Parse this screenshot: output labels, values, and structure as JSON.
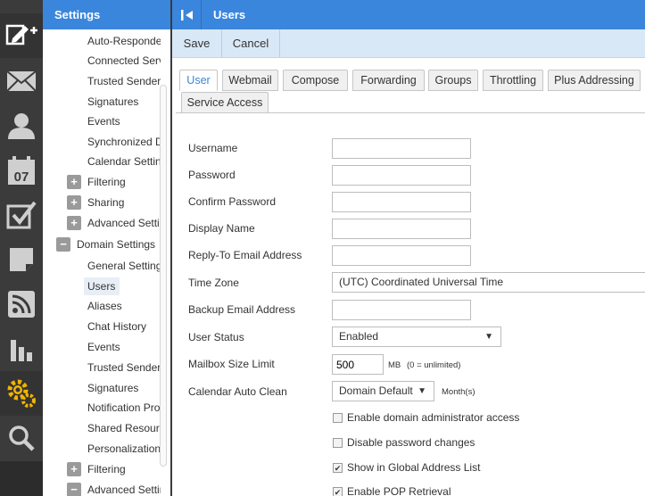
{
  "rail": {
    "items": [
      {
        "icon": "compose-new-icon",
        "active": true
      },
      {
        "icon": "mail-icon"
      },
      {
        "icon": "contacts-icon"
      },
      {
        "icon": "calendar-icon",
        "badge": "07"
      },
      {
        "icon": "tasks-icon"
      },
      {
        "icon": "notes-icon"
      },
      {
        "icon": "rss-icon"
      },
      {
        "icon": "reports-icon"
      },
      {
        "icon": "settings-gear-icon",
        "active": true
      },
      {
        "icon": "search-icon"
      }
    ],
    "accent_color": "#f2b400"
  },
  "tree": {
    "header": "Settings",
    "items": [
      {
        "label": "Auto-Responder"
      },
      {
        "label": "Connected Services"
      },
      {
        "label": "Trusted Senders"
      },
      {
        "label": "Signatures"
      },
      {
        "label": "Events"
      },
      {
        "label": "Synchronized Devices"
      },
      {
        "label": "Calendar Settings"
      },
      {
        "label": "Filtering",
        "expander": "+"
      },
      {
        "label": "Sharing",
        "expander": "+"
      },
      {
        "label": "Advanced Settings",
        "expander": "+"
      },
      {
        "label": "Domain Settings",
        "expander": "−"
      },
      {
        "label": "General Settings"
      },
      {
        "label": "Users",
        "selected": true
      },
      {
        "label": "Aliases"
      },
      {
        "label": "Chat History"
      },
      {
        "label": "Events"
      },
      {
        "label": "Trusted Senders"
      },
      {
        "label": "Signatures"
      },
      {
        "label": "Notification Profiles"
      },
      {
        "label": "Shared Resources"
      },
      {
        "label": "Personalization"
      },
      {
        "label": "Filtering",
        "expander": "+"
      },
      {
        "label": "Advanced Settings",
        "expander": "−"
      }
    ]
  },
  "main": {
    "title": "Users",
    "toolbar": {
      "save": "Save",
      "cancel": "Cancel"
    },
    "tabs": [
      {
        "label": "User",
        "active": true
      },
      {
        "label": "Webmail"
      },
      {
        "label": "Compose"
      },
      {
        "label": "Forwarding"
      },
      {
        "label": "Groups"
      },
      {
        "label": "Throttling"
      },
      {
        "label": "Plus Addressing"
      },
      {
        "label": "Service Access"
      }
    ],
    "form": {
      "username": {
        "label": "Username",
        "value": ""
      },
      "password": {
        "label": "Password",
        "value": ""
      },
      "confirm_password": {
        "label": "Confirm Password",
        "value": ""
      },
      "display_name": {
        "label": "Display Name",
        "value": ""
      },
      "reply_to": {
        "label": "Reply-To Email Address",
        "value": ""
      },
      "time_zone": {
        "label": "Time Zone",
        "value": "(UTC) Coordinated Universal Time"
      },
      "backup_email": {
        "label": "Backup Email Address",
        "value": ""
      },
      "user_status": {
        "label": "User Status",
        "value": "Enabled"
      },
      "mailbox_size": {
        "label": "Mailbox Size Limit",
        "value": "500",
        "unit": "MB",
        "hint": "(0 = unlimited)"
      },
      "calendar_clean": {
        "label": "Calendar Auto Clean",
        "value": "Domain Default",
        "unit": "Month(s)"
      }
    },
    "checkboxes": [
      {
        "label": "Enable domain administrator access",
        "checked": false
      },
      {
        "label": "Disable password changes",
        "checked": false
      },
      {
        "label": "Show in Global Address List",
        "checked": true
      },
      {
        "label": "Enable POP Retrieval",
        "checked": true
      }
    ]
  },
  "colors": {
    "header_blue": "#3a86dc",
    "toolbar_blue": "#d9e8f7",
    "rail": "#3b3b3b"
  }
}
